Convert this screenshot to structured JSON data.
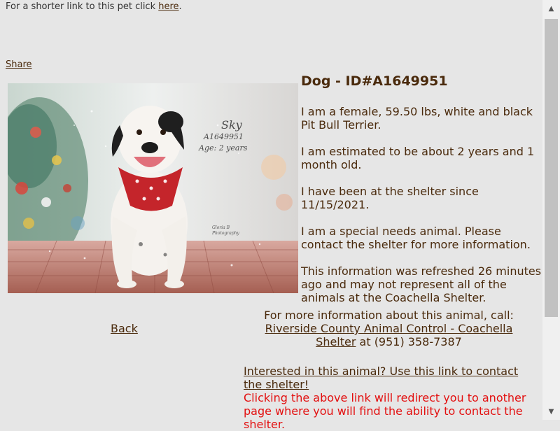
{
  "top": {
    "shortlink_prefix": "For a shorter link to this pet click ",
    "shortlink_link": "here",
    "shortlink_suffix": "."
  },
  "share_label": "Share",
  "photo": {
    "name": "Sky",
    "id": "A1649951",
    "age": "Age: 2 years",
    "watermark_line1": "Gloria B",
    "watermark_line2": "Photography"
  },
  "pet": {
    "heading": "Dog - ID#A1649951",
    "description": "I am a female, 59.50 lbs, white and black Pit Bull Terrier.",
    "age_estimate": "I am estimated to be about 2 years and 1 month old.",
    "shelter_since": "I have been at the shelter since 11/15/2021.",
    "special_needs": "I am a special needs animal. Please contact the shelter for more information.",
    "refresh_note": "This information was refreshed 26 minutes ago and may not represent all of the animals at the Coachella Shelter."
  },
  "back_label": "Back",
  "contact": {
    "intro": "For more information about this animal, call:",
    "shelter_link": "Riverside County Animal Control - Coachella Shelter",
    "phone": " at (951) 358-7387"
  },
  "interested_link": "Interested in this animal? Use this link to contact the shelter!",
  "redirect_note": "Clicking the above link will redirect you to another page where you will find the ability to contact the shelter."
}
